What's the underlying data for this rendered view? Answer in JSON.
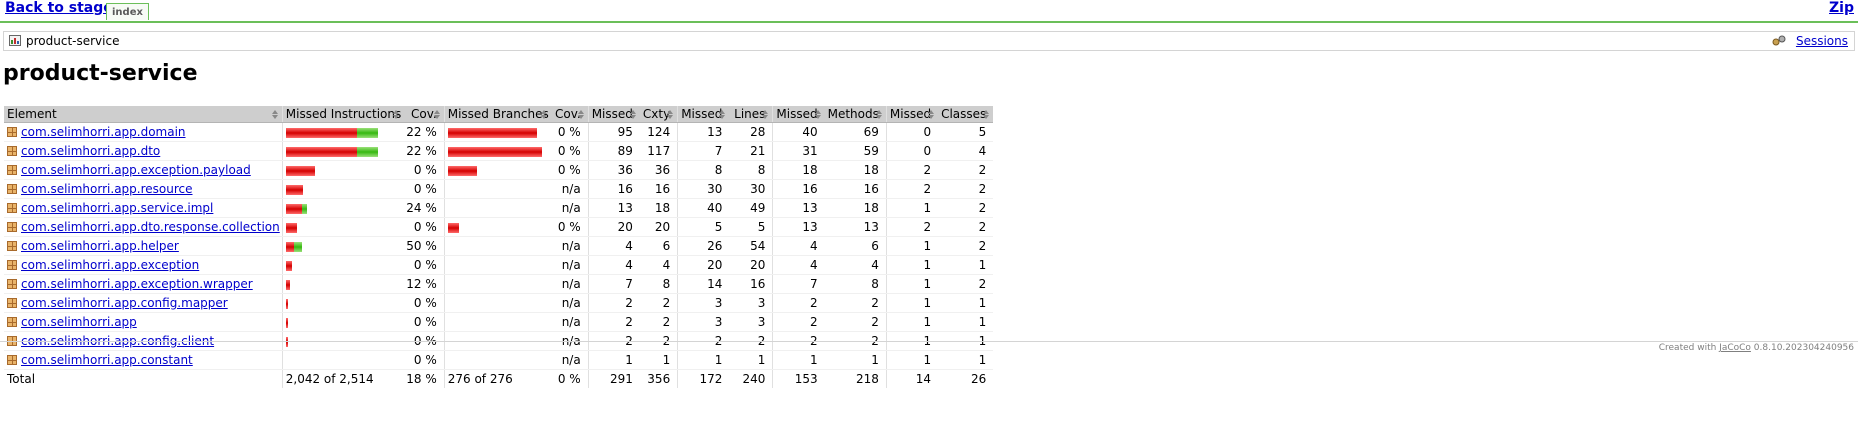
{
  "nav": {
    "back_label": "Back to stage",
    "tab_label": "index",
    "zip_label": "Zip"
  },
  "breadcrumb": {
    "label": "product-service",
    "sessions_label": "Sessions"
  },
  "page_title": "product-service",
  "table": {
    "headers": [
      "Element",
      "Missed Instructions",
      "Cov.",
      "Missed Branches",
      "Cov.",
      "Missed",
      "Cxty",
      "Missed",
      "Lines",
      "Missed",
      "Methods",
      "Missed",
      "Classes"
    ],
    "rows": [
      {
        "name": "com.selimhorri.app.domain",
        "instr_missed": "",
        "instr_cov": "22 %",
        "br_cov": "0 %",
        "cxty_missed": "95",
        "cxty": "124",
        "lines_missed": "13",
        "lines": "28",
        "methods_missed": "40",
        "methods": "69",
        "classes_missed": "0",
        "classes": "5",
        "instr_bar": {
          "missed": 0.75,
          "covered": 0.22
        },
        "br_bar": {
          "missed": 0.95,
          "covered": 0
        }
      },
      {
        "name": "com.selimhorri.app.dto",
        "instr_missed": "",
        "instr_cov": "22 %",
        "br_cov": "0 %",
        "cxty_missed": "89",
        "cxty": "117",
        "lines_missed": "7",
        "lines": "21",
        "methods_missed": "31",
        "methods": "59",
        "classes_missed": "0",
        "classes": "4",
        "instr_bar": {
          "missed": 0.75,
          "covered": 0.22
        },
        "br_bar": {
          "missed": 1,
          "covered": 0
        }
      },
      {
        "name": "com.selimhorri.app.exception.payload",
        "instr_missed": "",
        "instr_cov": "0 %",
        "br_cov": "0 %",
        "cxty_missed": "36",
        "cxty": "36",
        "lines_missed": "8",
        "lines": "8",
        "methods_missed": "18",
        "methods": "18",
        "classes_missed": "2",
        "classes": "2",
        "instr_bar": {
          "missed": 0.31,
          "covered": 0
        },
        "br_bar": {
          "missed": 0.31,
          "covered": 0
        }
      },
      {
        "name": "com.selimhorri.app.resource",
        "instr_missed": "",
        "instr_cov": "0 %",
        "br_cov": "n/a",
        "cxty_missed": "16",
        "cxty": "16",
        "lines_missed": "30",
        "lines": "30",
        "methods_missed": "16",
        "methods": "16",
        "classes_missed": "2",
        "classes": "2",
        "instr_bar": {
          "missed": 0.18,
          "covered": 0
        },
        "br_bar": null
      },
      {
        "name": "com.selimhorri.app.service.impl",
        "instr_missed": "",
        "instr_cov": "24 %",
        "br_cov": "n/a",
        "cxty_missed": "13",
        "cxty": "18",
        "lines_missed": "40",
        "lines": "49",
        "methods_missed": "13",
        "methods": "18",
        "classes_missed": "1",
        "classes": "2",
        "instr_bar": {
          "missed": 0.17,
          "covered": 0.05
        },
        "br_bar": null
      },
      {
        "name": "com.selimhorri.app.dto.response.collection",
        "instr_missed": "",
        "instr_cov": "0 %",
        "br_cov": "0 %",
        "cxty_missed": "20",
        "cxty": "20",
        "lines_missed": "5",
        "lines": "5",
        "methods_missed": "13",
        "methods": "13",
        "classes_missed": "2",
        "classes": "2",
        "instr_bar": {
          "missed": 0.12,
          "covered": 0
        },
        "br_bar": {
          "missed": 0.12,
          "covered": 0
        }
      },
      {
        "name": "com.selimhorri.app.helper",
        "instr_missed": "",
        "instr_cov": "50 %",
        "br_cov": "n/a",
        "cxty_missed": "4",
        "cxty": "6",
        "lines_missed": "26",
        "lines": "54",
        "methods_missed": "4",
        "methods": "6",
        "classes_missed": "1",
        "classes": "2",
        "instr_bar": {
          "missed": 0.09,
          "covered": 0.08
        },
        "br_bar": null
      },
      {
        "name": "com.selimhorri.app.exception",
        "instr_missed": "",
        "instr_cov": "0 %",
        "br_cov": "n/a",
        "cxty_missed": "4",
        "cxty": "4",
        "lines_missed": "20",
        "lines": "20",
        "methods_missed": "4",
        "methods": "4",
        "classes_missed": "1",
        "classes": "1",
        "instr_bar": {
          "missed": 0.06,
          "covered": 0
        },
        "br_bar": null
      },
      {
        "name": "com.selimhorri.app.exception.wrapper",
        "instr_missed": "",
        "instr_cov": "12 %",
        "br_cov": "n/a",
        "cxty_missed": "7",
        "cxty": "8",
        "lines_missed": "14",
        "lines": "16",
        "methods_missed": "7",
        "methods": "8",
        "classes_missed": "1",
        "classes": "2",
        "instr_bar": {
          "missed": 0.04,
          "covered": 0
        },
        "br_bar": null
      },
      {
        "name": "com.selimhorri.app.config.mapper",
        "instr_missed": "",
        "instr_cov": "0 %",
        "br_cov": "n/a",
        "cxty_missed": "2",
        "cxty": "2",
        "lines_missed": "3",
        "lines": "3",
        "methods_missed": "2",
        "methods": "2",
        "classes_missed": "1",
        "classes": "1",
        "instr_bar": {
          "missed": 0.01,
          "covered": 0
        },
        "br_bar": null
      },
      {
        "name": "com.selimhorri.app",
        "instr_missed": "",
        "instr_cov": "0 %",
        "br_cov": "n/a",
        "cxty_missed": "2",
        "cxty": "2",
        "lines_missed": "3",
        "lines": "3",
        "methods_missed": "2",
        "methods": "2",
        "classes_missed": "1",
        "classes": "1",
        "instr_bar": {
          "missed": 0.01,
          "covered": 0
        },
        "br_bar": null
      },
      {
        "name": "com.selimhorri.app.config.client",
        "instr_missed": "",
        "instr_cov": "0 %",
        "br_cov": "n/a",
        "cxty_missed": "2",
        "cxty": "2",
        "lines_missed": "2",
        "lines": "2",
        "methods_missed": "2",
        "methods": "2",
        "classes_missed": "1",
        "classes": "1",
        "instr_bar": {
          "missed": 0.01,
          "covered": 0
        },
        "br_bar": null
      },
      {
        "name": "com.selimhorri.app.constant",
        "instr_missed": "",
        "instr_cov": "0 %",
        "br_cov": "n/a",
        "cxty_missed": "1",
        "cxty": "1",
        "lines_missed": "1",
        "lines": "1",
        "methods_missed": "1",
        "methods": "1",
        "classes_missed": "1",
        "classes": "1",
        "instr_bar": null,
        "br_bar": null
      }
    ],
    "total": {
      "label": "Total",
      "instr": "2,042 of 2,514",
      "instr_cov": "18 %",
      "br": "276 of 276",
      "br_cov": "0 %",
      "cxty_missed": "291",
      "cxty": "356",
      "lines_missed": "172",
      "lines": "240",
      "methods_missed": "153",
      "methods": "218",
      "classes_missed": "14",
      "classes": "26"
    }
  },
  "footer": {
    "prefix": "Created with ",
    "link": "JaCoCo",
    "suffix": " 0.8.10.202304240956"
  },
  "colors": {
    "accent_green": "#6bbf59",
    "bar_red": "#d40000",
    "bar_green": "#35b80f",
    "link": "#0000cc"
  }
}
